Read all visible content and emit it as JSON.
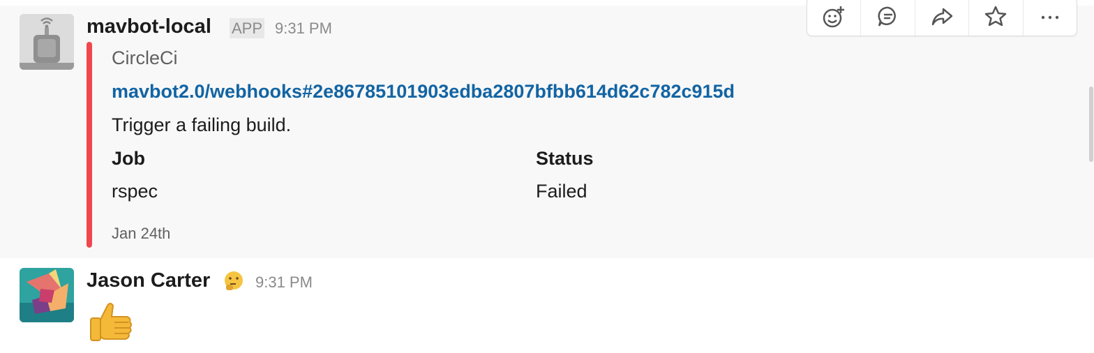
{
  "messages": [
    {
      "author": "mavbot-local",
      "badge": "APP",
      "time": "9:31 PM",
      "attachment": {
        "color": "#f0474f",
        "author_name": "CircleCi",
        "title_link": "mavbot2.0/webhooks#2e86785101903edba2807bfbb614d62c782c915d",
        "text": "Trigger a failing build.",
        "fields": [
          {
            "title": "Job",
            "value": "rspec"
          },
          {
            "title": "Status",
            "value": "Failed"
          }
        ],
        "footer": "Jan 24th"
      }
    },
    {
      "author": "Jason Carter",
      "status_icon": "thinking-face-emoji",
      "time": "9:31 PM",
      "body_icon": "thumbs-up-emoji"
    }
  ],
  "message_actions": [
    "add-reaction-icon",
    "reply-in-thread-icon",
    "share-message-icon",
    "save-star-icon",
    "more-actions-icon"
  ]
}
